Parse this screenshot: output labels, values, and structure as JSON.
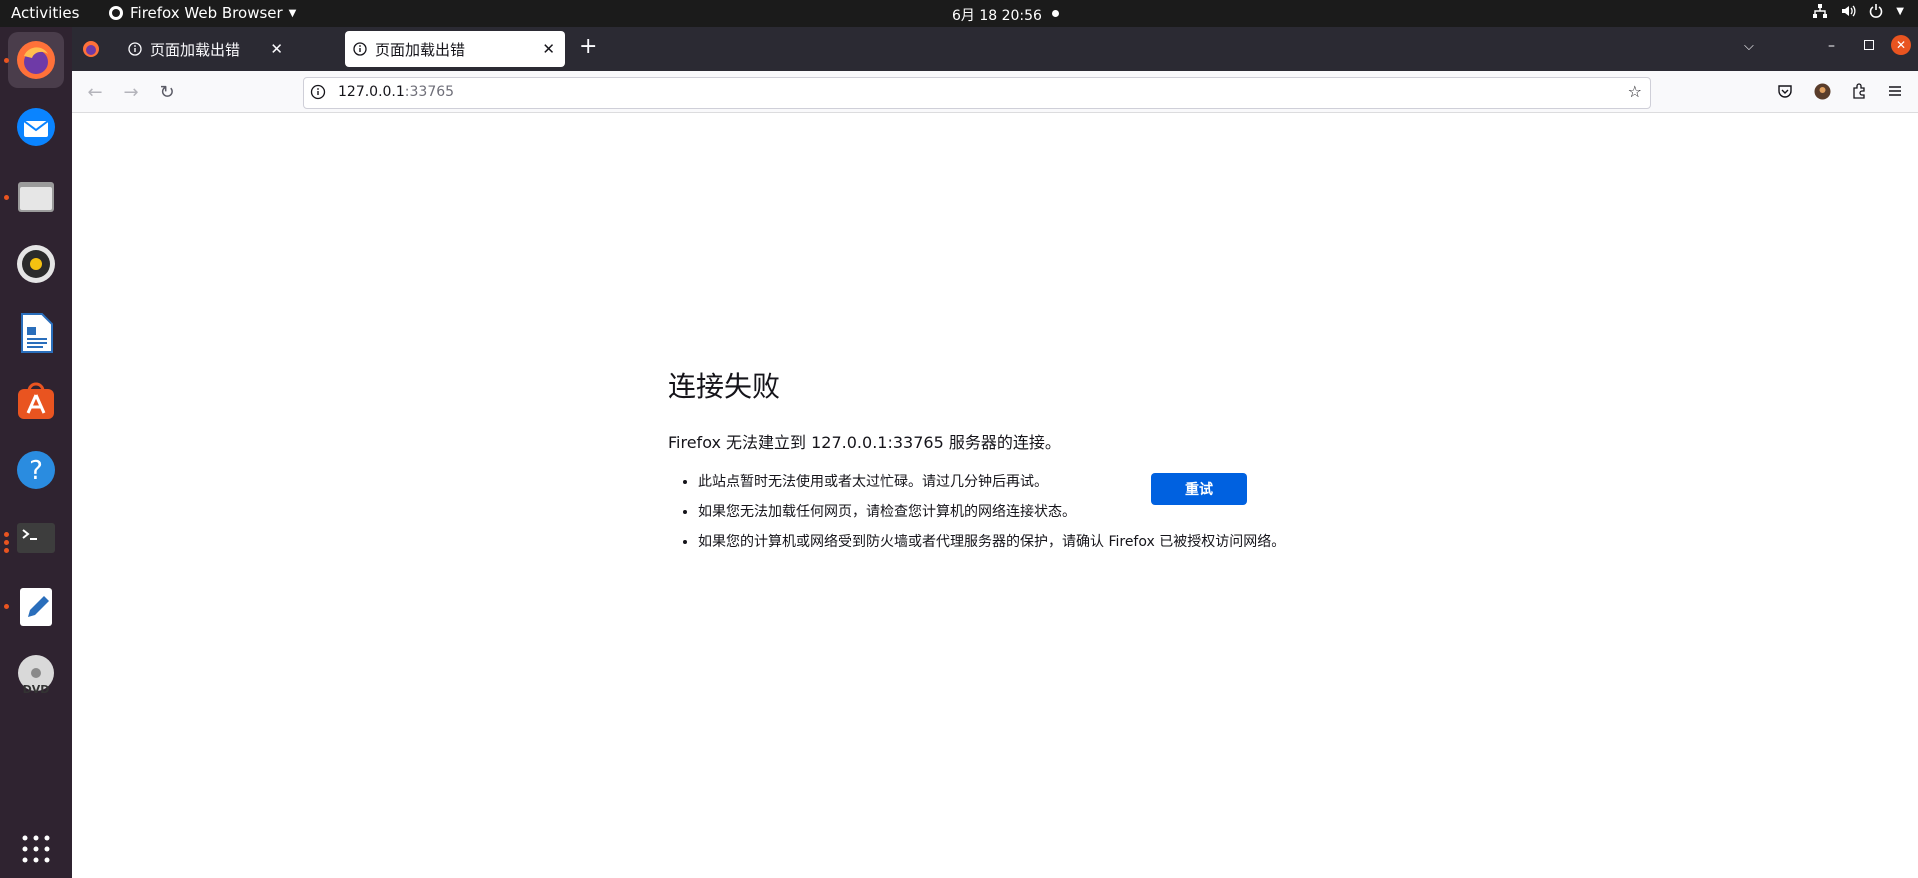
{
  "topbar": {
    "activities": "Activities",
    "app_menu": "Firefox Web Browser",
    "clock": "6月 18  20:56"
  },
  "dock": {
    "items": [
      {
        "name": "firefox-icon",
        "color": "#ff7139"
      },
      {
        "name": "thunderbird-icon",
        "color": "#0a84ff"
      },
      {
        "name": "files-icon",
        "color": "#c9c9c9"
      },
      {
        "name": "rhythmbox-icon",
        "color": "#f5c211"
      },
      {
        "name": "libreoffice-writer-icon",
        "color": "#2a6ebb"
      },
      {
        "name": "app-center-icon",
        "color": "#e95420"
      },
      {
        "name": "help-icon",
        "color": "#2a8ce0"
      },
      {
        "name": "terminal-icon",
        "color": "#3d3d3d"
      },
      {
        "name": "text-editor-icon",
        "color": "#ffffff"
      },
      {
        "name": "dvd-icon",
        "color": "#cfcfcf"
      }
    ],
    "apps_grid": "show-applications-icon"
  },
  "tabs": [
    {
      "label": "页面加载出错",
      "active": false
    },
    {
      "label": "页面加载出错",
      "active": true
    }
  ],
  "url": {
    "host": "127.0.0.1",
    "port": ":33765"
  },
  "error": {
    "title": "连接失败",
    "description": "Firefox 无法建立到 127.0.0.1:33765 服务器的连接。",
    "bullets": [
      "此站点暂时无法使用或者太过忙碌。请过几分钟后再试。",
      "如果您无法加载任何网页，请检查您计算机的网络连接状态。",
      "如果您的计算机或网络受到防火墙或者代理服务器的保护，请确认 Firefox 已被授权访问网络。"
    ],
    "retry_label": "重试"
  },
  "colors": {
    "accent": "#0061e0",
    "ubuntu_orange": "#e95420",
    "dock_bg": "#2f2330",
    "tabbar_bg": "#2b2a33"
  }
}
